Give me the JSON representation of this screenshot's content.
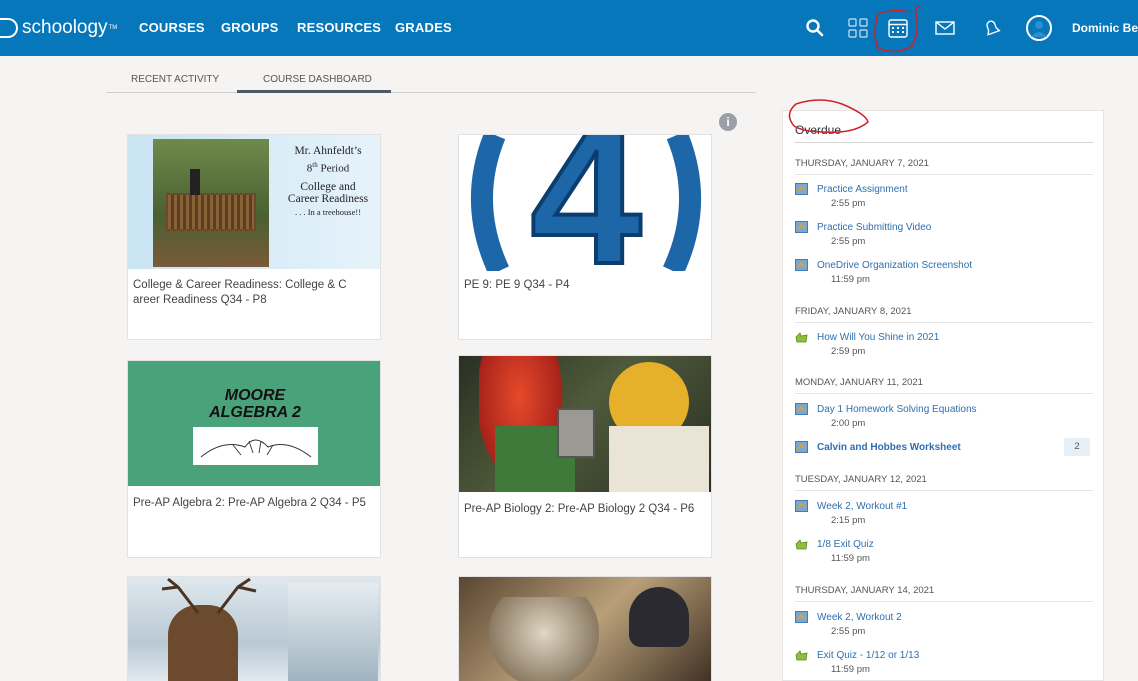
{
  "app": {
    "logo_text": "schoology",
    "logo_mark": "TM"
  },
  "nav": {
    "items": [
      "COURSES",
      "GROUPS",
      "RESOURCES",
      "GRADES"
    ]
  },
  "user": {
    "name": "Dominic Bette"
  },
  "tabs": {
    "recent": "RECENT ACTIVITY",
    "dashboard": "COURSE DASHBOARD"
  },
  "help": {
    "symbol": "i"
  },
  "courses": [
    {
      "title": "College & Career Readiness: College & C areer Readiness Q34 - P8",
      "image_text": {
        "line1": "Mr. Ahnfeldt’s",
        "line2_pre": "8",
        "line2_sup": "th",
        "line2_post": " Period",
        "line3": "College and",
        "line4": "Career Readiness",
        "line5": ". . . In a treehouse!!"
      }
    },
    {
      "title": "PE 9: PE 9 Q34 - P4",
      "image_text": {
        "numeral": "4"
      }
    },
    {
      "title": "Pre-AP Algebra 2: Pre-AP Algebra 2 Q34 - P5",
      "image_text": {
        "line1": "MOORE",
        "line2": "ALGEBRA 2"
      }
    },
    {
      "title": "Pre-AP Biology 2: Pre-AP Biology 2 Q34 - P6"
    },
    {
      "title": ""
    },
    {
      "title": ""
    }
  ],
  "overdue": {
    "heading": "Overdue",
    "groups": [
      {
        "date": "THURSDAY, JANUARY 7, 2021",
        "items": [
          {
            "label": "Practice Assignment",
            "time": "2:55 pm",
            "icon": "assignment-icon"
          },
          {
            "label": "Practice Submitting Video",
            "time": "2:55 pm",
            "icon": "assignment-icon"
          },
          {
            "label": "OneDrive Organization Screenshot",
            "time": "11:59 pm",
            "icon": "assignment-icon"
          }
        ]
      },
      {
        "date": "FRIDAY, JANUARY 8, 2021",
        "items": [
          {
            "label": "How Will You Shine in 2021",
            "time": "2:59 pm",
            "icon": "assessment-icon"
          }
        ]
      },
      {
        "date": "MONDAY, JANUARY 11, 2021",
        "items": [
          {
            "label": "Day 1 Homework Solving Equations",
            "time": "2:00 pm",
            "icon": "assignment-icon"
          },
          {
            "label": "Calvin and Hobbes Worksheet",
            "time": "",
            "icon": "assignment-icon",
            "badge": "2"
          }
        ]
      },
      {
        "date": "TUESDAY, JANUARY 12, 2021",
        "items": [
          {
            "label": "Week 2, Workout #1",
            "time": "2:15 pm",
            "icon": "assignment-icon"
          },
          {
            "label": "1/8 Exit Quiz",
            "time": "11:59 pm",
            "icon": "assessment-icon"
          }
        ]
      },
      {
        "date": "THURSDAY, JANUARY 14, 2021",
        "items": [
          {
            "label": "Week 2, Workout 2",
            "time": "2:55 pm",
            "icon": "assignment-icon"
          },
          {
            "label": "Exit Quiz - 1/12 or 1/13",
            "time": "11:59 pm",
            "icon": "assessment-icon"
          }
        ]
      }
    ]
  },
  "colors": {
    "topbar": "#0677ba",
    "link": "#2f6fae",
    "annotation": "#d11f2a"
  }
}
